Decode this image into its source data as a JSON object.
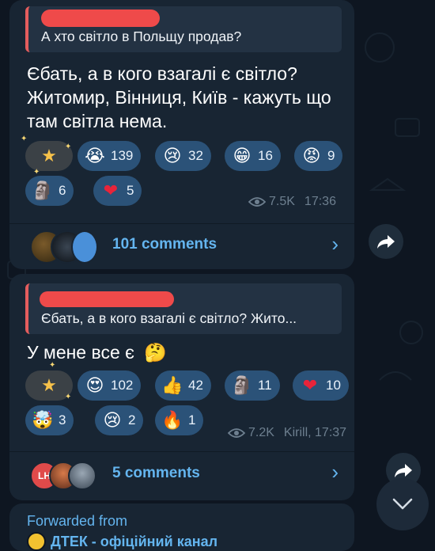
{
  "post1": {
    "reply_quote": "А хто світло в Польщу продав?",
    "text": "Єбать, а в кого взагалі є світло? Житомир, Вінниця, Київ - кажуть що там світла нема.",
    "reactions_row1": [
      {
        "icon": "star-icon",
        "glyph": "★",
        "count": ""
      },
      {
        "icon": "loudly-crying-face-icon",
        "glyph": "😭",
        "count": "139"
      },
      {
        "icon": "crying-face-icon",
        "glyph": "😢",
        "count": "32"
      },
      {
        "icon": "grinning-face-icon",
        "glyph": "😁",
        "count": "16"
      },
      {
        "icon": "angry-face-icon",
        "glyph": "😡",
        "count": "9"
      }
    ],
    "reactions_row2": [
      {
        "icon": "moai-icon",
        "glyph": "🗿",
        "count": "6"
      },
      {
        "icon": "red-heart-icon",
        "glyph": "❤",
        "count": "5"
      }
    ],
    "views": "7.5K",
    "time": "17:36",
    "comments": "101 comments"
  },
  "post2": {
    "reply_quote": "Єбать, а в кого взагалі є світло? Жито...",
    "text": "У мене все є",
    "text_emoji": "🤔",
    "reactions_row1": [
      {
        "icon": "star-icon",
        "glyph": "★",
        "count": ""
      },
      {
        "icon": "heart-eyes-icon",
        "glyph": "😍",
        "count": "102"
      },
      {
        "icon": "thumbs-up-icon",
        "glyph": "👍",
        "count": "42"
      },
      {
        "icon": "moai-icon",
        "glyph": "🗿",
        "count": "11"
      },
      {
        "icon": "red-heart-icon",
        "glyph": "❤",
        "count": "10"
      }
    ],
    "reactions_row2": [
      {
        "icon": "exploding-head-icon",
        "glyph": "🤯",
        "count": "3"
      },
      {
        "icon": "crying-face-icon",
        "glyph": "😢",
        "count": "2"
      },
      {
        "icon": "fire-icon",
        "glyph": "🔥",
        "count": "1"
      }
    ],
    "views": "7.2K",
    "author_time": "Kirill, 17:37",
    "avatar_initials": "LH",
    "comments": "5 comments"
  },
  "post3": {
    "forwarded_label": "Forwarded from",
    "channel": "ДТЕК - офіційний канал"
  },
  "colors": {
    "background": "#0e1621",
    "bubble": "#182533",
    "reaction_chip": "#2b5278",
    "link": "#64b5ef",
    "reply_accent": "#e45d5d"
  }
}
